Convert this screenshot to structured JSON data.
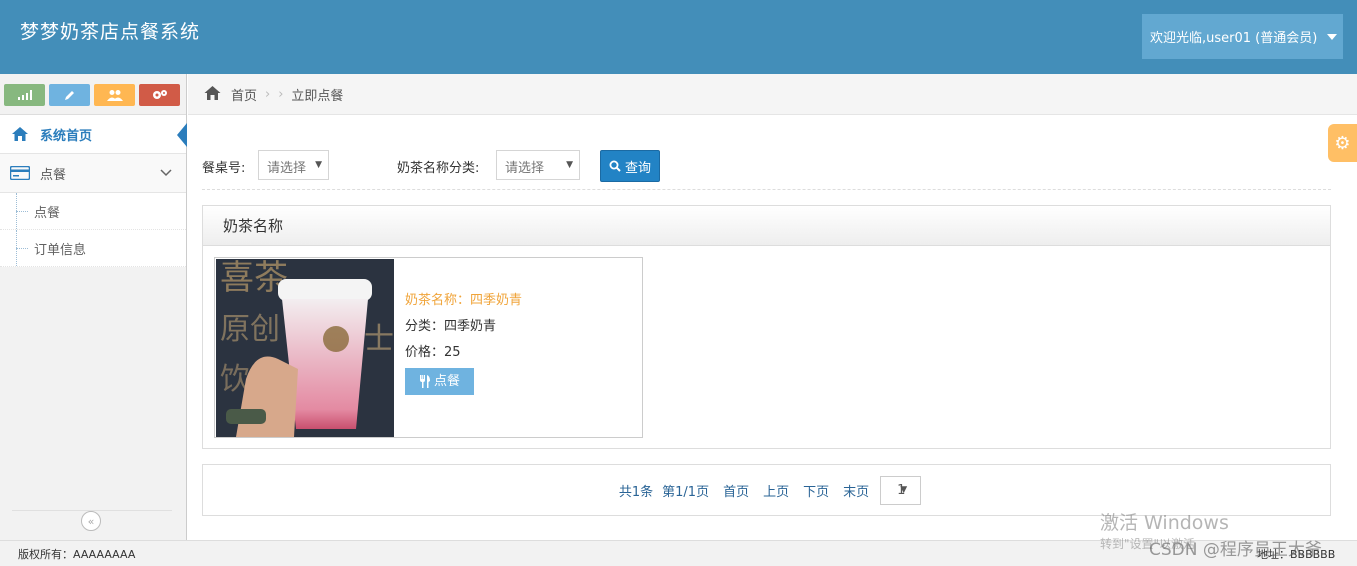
{
  "header": {
    "title": "梦梦奶茶店点餐系统",
    "user_label": "欢迎光临,user01 (普通会员)"
  },
  "sidebar": {
    "shortcut_icons": [
      "signal-icon",
      "pencil-icon",
      "users-icon",
      "cogs-icon"
    ],
    "items": [
      {
        "label": "系统首页",
        "icon": "home-icon",
        "active": true
      },
      {
        "label": "点餐",
        "icon": "credit-card-icon",
        "expanded": true
      }
    ],
    "sub_items": [
      {
        "label": "点餐"
      },
      {
        "label": "订单信息"
      }
    ]
  },
  "breadcrumb": {
    "home": "首页",
    "current": "立即点餐"
  },
  "filters": {
    "table_label": "餐桌号:",
    "table_value": "请选择",
    "category_label": "奶茶名称分类:",
    "category_value": "请选择",
    "search_label": "查询"
  },
  "panel": {
    "title": "奶茶名称",
    "products": [
      {
        "name_line": "奶茶名称：四季奶青",
        "category_line": "分类：四季奶青",
        "price_line": "价格：25",
        "order_label": "点餐"
      }
    ]
  },
  "pagination": {
    "total": "共1条",
    "page": "第1/1页",
    "first": "首页",
    "prev": "上页",
    "next": "下页",
    "last": "末页",
    "selected": "1"
  },
  "footer": {
    "copyright": "版权所有：AAAAAAAA",
    "address": "地址：BBBBBB"
  },
  "watermark": {
    "line1": "激活 Windows",
    "line2": "转到\"设置\"以激活",
    "csdn": "CSDN @程序员王大爷"
  },
  "colors": {
    "header": "#438eb9",
    "user_menu": "#62a8d1",
    "primary": "#2283c5",
    "product_name": "#f0a43a"
  }
}
